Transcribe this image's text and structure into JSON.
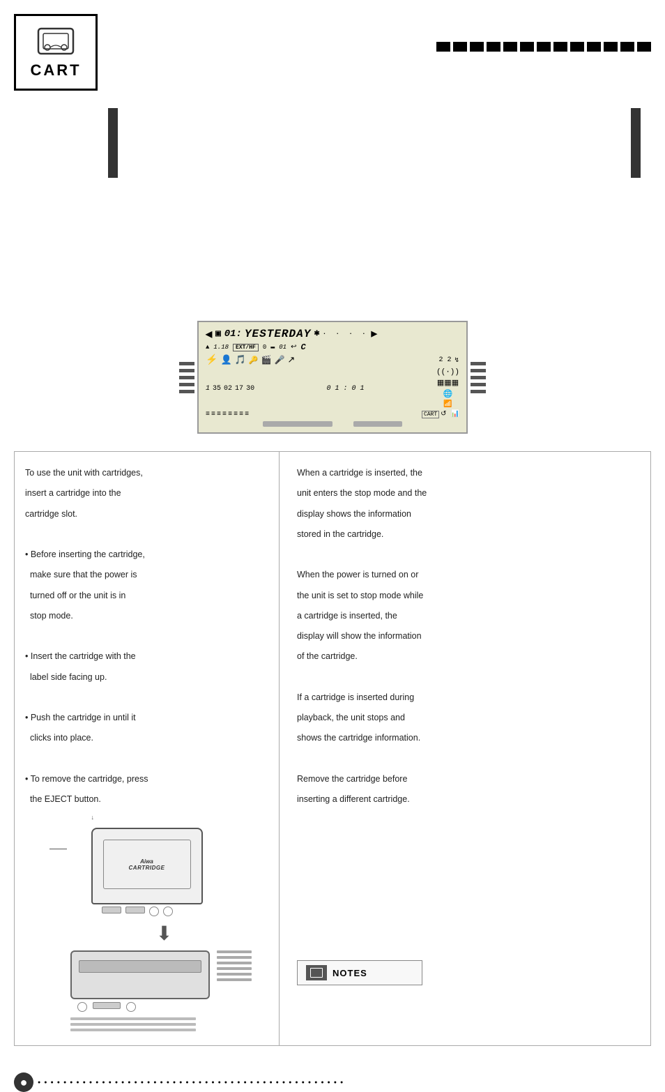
{
  "header": {
    "cart_label": "CART",
    "dash_count": 13
  },
  "display": {
    "track_num": "01:",
    "track_title": "YESTERDAY",
    "arrow_right": "▶",
    "dots": "· · · ·",
    "row2_items": [
      "▲",
      "1.18",
      "EXT/HF",
      "0",
      "▬▬",
      "01",
      "↩",
      "C"
    ],
    "row3_icons": [
      "⛤",
      "🎵",
      "📻",
      "🔉",
      "🎬",
      "🎤",
      "↗"
    ],
    "row3_nums": [
      "1",
      "35",
      "02",
      "17",
      "30",
      "01:01"
    ],
    "row5_bars": [
      "≡",
      "≡",
      "≡",
      "≡",
      "≡",
      "≡",
      "≡",
      "≡"
    ],
    "bottom_segs": [
      "seg1",
      "seg2"
    ]
  },
  "main_left": {
    "heading": "",
    "paragraphs": [
      "To use the unit with cartridges,",
      "insert a cartridge into the",
      "cartridge slot.",
      "",
      "• Before inserting the cartridge,",
      "  make sure that the power is",
      "  turned off or the unit is in",
      "  stop mode.",
      "",
      "• Insert the cartridge with the",
      "  label side facing up.",
      "",
      "• Push the cartridge in until it",
      "  clicks into place.",
      "",
      "• To remove the cartridge, press",
      "  the EJECT button."
    ],
    "pointer_label": ""
  },
  "main_right": {
    "paragraphs": [
      "When a cartridge is inserted, the",
      "unit enters the stop mode and the",
      "display shows the information",
      "stored in the cartridge.",
      "",
      "When the power is turned on or",
      "the unit is set to stop mode while",
      "a cartridge is inserted, the",
      "display will show the information",
      "of the cartridge.",
      "",
      "If a cartridge is inserted during",
      "playback, the unit stops and",
      "shows the cartridge information.",
      "",
      "Remove the cartridge before",
      "inserting a different cartridge."
    ],
    "notes_label": "NOTES",
    "notes_sub": ""
  },
  "footer": {
    "page_num": "●",
    "dot_count": 50
  },
  "colors": {
    "black": "#000000",
    "dark_gray": "#333333",
    "mid_gray": "#888888",
    "light_gray": "#cccccc",
    "display_bg": "#d4d4b8",
    "page_circle_bg": "#222222"
  }
}
